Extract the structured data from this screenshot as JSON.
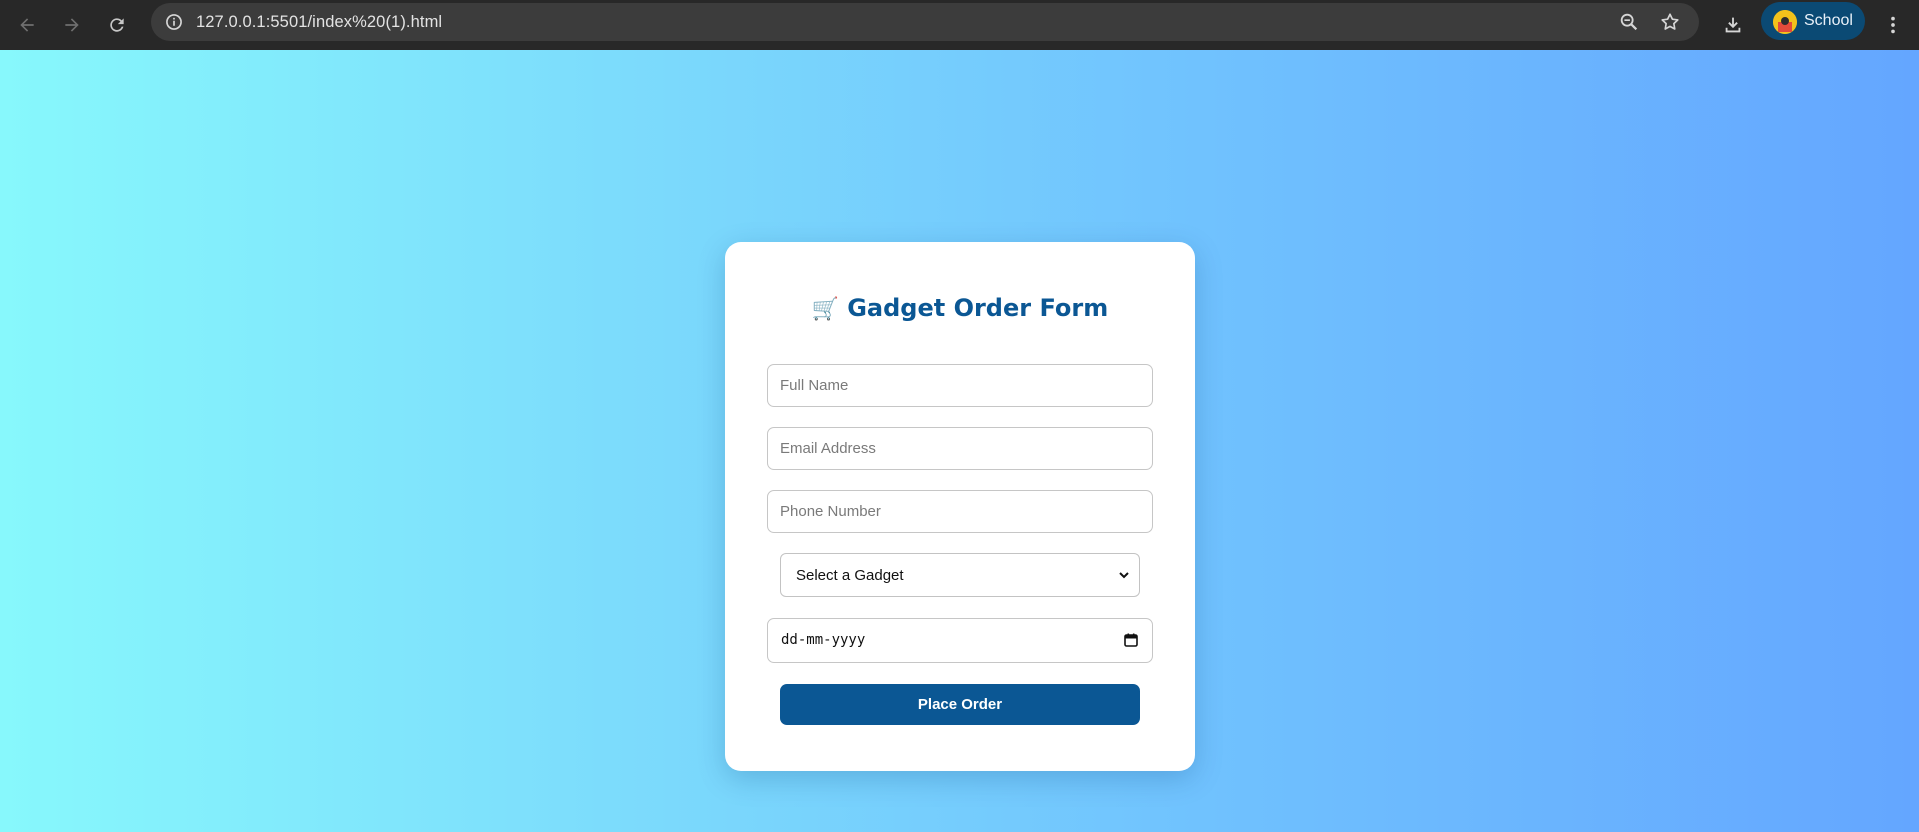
{
  "browser": {
    "url": "127.0.0.1:5501/index%20(1).html",
    "profile_label": "School",
    "icons": [
      "back-arrow-icon",
      "forward-arrow-icon",
      "reload-icon",
      "site-info-icon",
      "zoom-icon",
      "bookmark-star-icon",
      "download-icon",
      "menu-dots-icon"
    ]
  },
  "form": {
    "title_icon": "🛒",
    "title": "Gadget Order Form",
    "full_name_placeholder": "Full Name",
    "email_placeholder": "Email Address",
    "phone_placeholder": "Phone Number",
    "gadget_selected": "Select a Gadget",
    "date_placeholder": "dd-mm-yyyy",
    "submit_label": "Place Order"
  },
  "colors": {
    "accent": "#0b5794",
    "gradient_start": "#87f8fc",
    "gradient_end": "#64a6ff",
    "toolbar": "#282828",
    "profile_chip": "#0b4a74"
  }
}
